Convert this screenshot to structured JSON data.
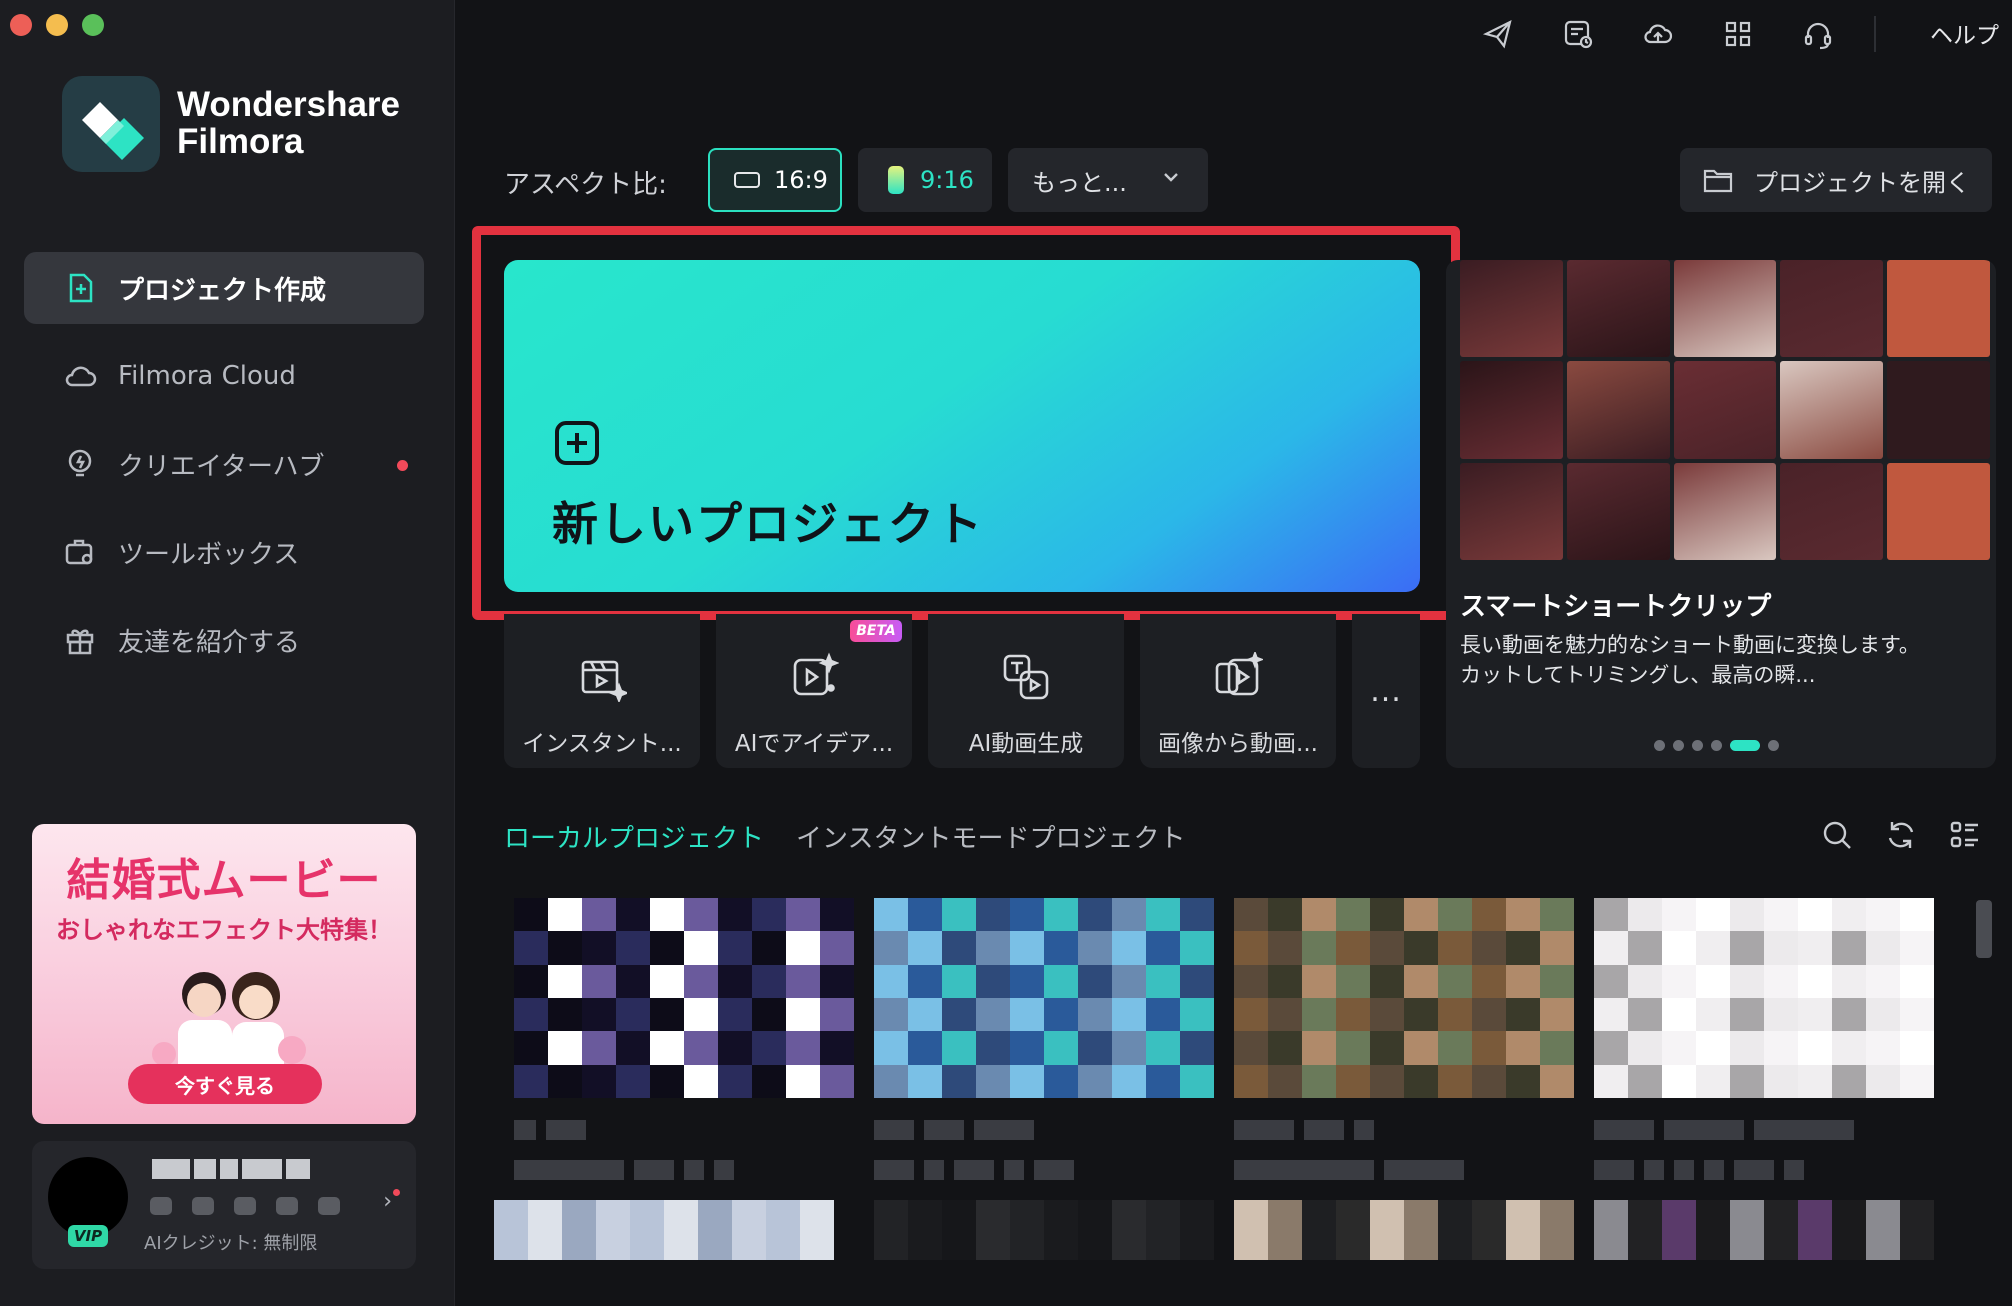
{
  "app": {
    "brand_line1": "Wondershare",
    "brand_line2": "Filmora",
    "help_label": "ヘルプ"
  },
  "sidebar": {
    "items": [
      {
        "label": "プロジェクト作成",
        "icon": "add-project-icon",
        "active": true
      },
      {
        "label": "Filmora Cloud",
        "icon": "cloud-icon"
      },
      {
        "label": "クリエイターハブ",
        "icon": "bulb-icon",
        "notify": true
      },
      {
        "label": "ツールボックス",
        "icon": "toolbox-icon"
      },
      {
        "label": "友達を紹介する",
        "icon": "gift-icon"
      }
    ],
    "promo": {
      "title": "結婚式ムービー",
      "subtitle": "おしゃれなエフェクト大特集！",
      "button": "今すぐ見る"
    },
    "account": {
      "badge": "VIP",
      "credit": "AIクレジット: 無制限"
    }
  },
  "topbar": {
    "icons": [
      "send-icon",
      "task-history-icon",
      "cloud-upload-icon",
      "apps-grid-icon",
      "headset-icon"
    ]
  },
  "aspect": {
    "label": "アスペクト比:",
    "options": [
      "16:9",
      "9:16"
    ],
    "more_label": "もっと...",
    "selected": "16:9"
  },
  "open_project_label": "プロジェクトを開く",
  "hero": {
    "label": "新しいプロジェクト"
  },
  "tools": [
    {
      "label": "インスタント...",
      "icon": "instant-mode-icon"
    },
    {
      "label": "AIでアイデア...",
      "icon": "ai-idea-video-icon",
      "badge": "BETA"
    },
    {
      "label": "AI動画生成",
      "icon": "ai-text-to-video-icon"
    },
    {
      "label": "画像から動画...",
      "icon": "image-to-video-icon"
    }
  ],
  "tools_more": "...",
  "smart_clip": {
    "title": "スマートショートクリップ",
    "desc_line1": "長い動画を魅力的なショート動画に変換します。",
    "desc_line2": "カットしてトリミングし、最高の瞬...",
    "slides": 6,
    "active_slide": 5
  },
  "projects": {
    "tabs": [
      "ローカルプロジェクト",
      "インスタントモードプロジェクト"
    ],
    "active_tab": 0
  },
  "colors": {
    "accent": "#2de3c4",
    "highlight_frame": "#e2323f",
    "background": "#121316",
    "sidebar": "#1c1d21"
  }
}
